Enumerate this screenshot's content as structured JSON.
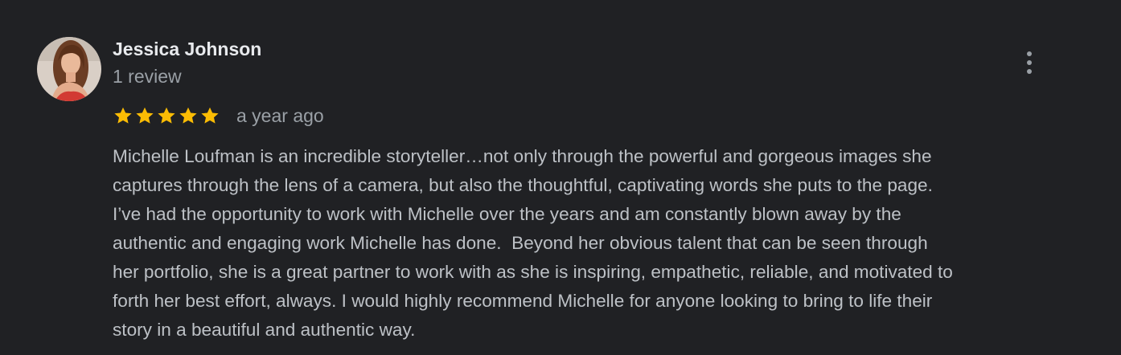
{
  "review": {
    "author_name": "Jessica Johnson",
    "review_count": "1 review",
    "rating": 5,
    "rating_max": 5,
    "time_ago": "a year ago",
    "menu_icon": "more-vert-icon",
    "star_color": "#fbbc04",
    "text_lines": [
      "Michelle Loufman is an incredible storyteller…not only through the powerful and gorgeous images she",
      "captures through the lens of a camera, but also the thoughtful, captivating words she puts to the page.",
      "I’ve had the opportunity to work with Michelle over the years and am constantly blown away by the",
      "authentic and engaging work Michelle has done.  Beyond her obvious talent that can be seen through",
      "her portfolio, she is a great partner to work with as she is inspiring, empathetic, reliable, and motivated to",
      "forth her best effort, always. I would highly recommend Michelle for anyone looking to bring to life their",
      "story in a beautiful and authentic way."
    ]
  }
}
